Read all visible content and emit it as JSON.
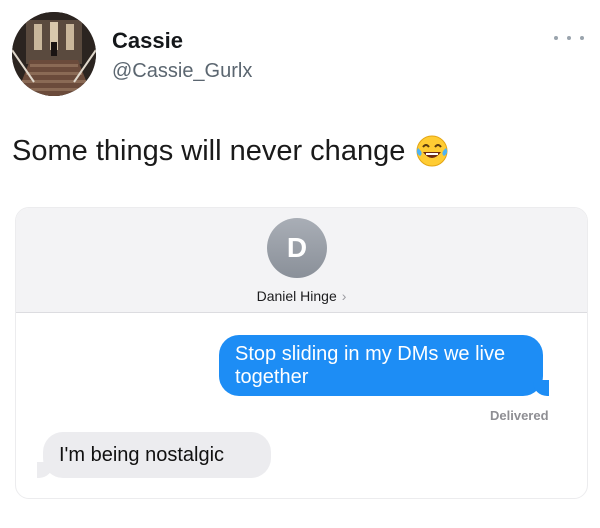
{
  "tweet": {
    "author_name": "Cassie",
    "author_handle": "@Cassie_Gurlx",
    "text": "Some things will never change",
    "emoji_icon": "laughing-tears-emoji-icon"
  },
  "screenshot": {
    "contact_initial": "D",
    "contact_name": "Daniel Hinge",
    "contact_chevron": "›",
    "messages": [
      {
        "direction": "sent",
        "text": "Stop sliding in my DMs we live together"
      },
      {
        "direction": "received",
        "text": "I'm being nostalgic"
      }
    ],
    "status": "Delivered"
  },
  "colors": {
    "sent_bubble": "#1d8df5",
    "received_bubble": "#ececef",
    "header_bg": "#f3f3f5"
  }
}
